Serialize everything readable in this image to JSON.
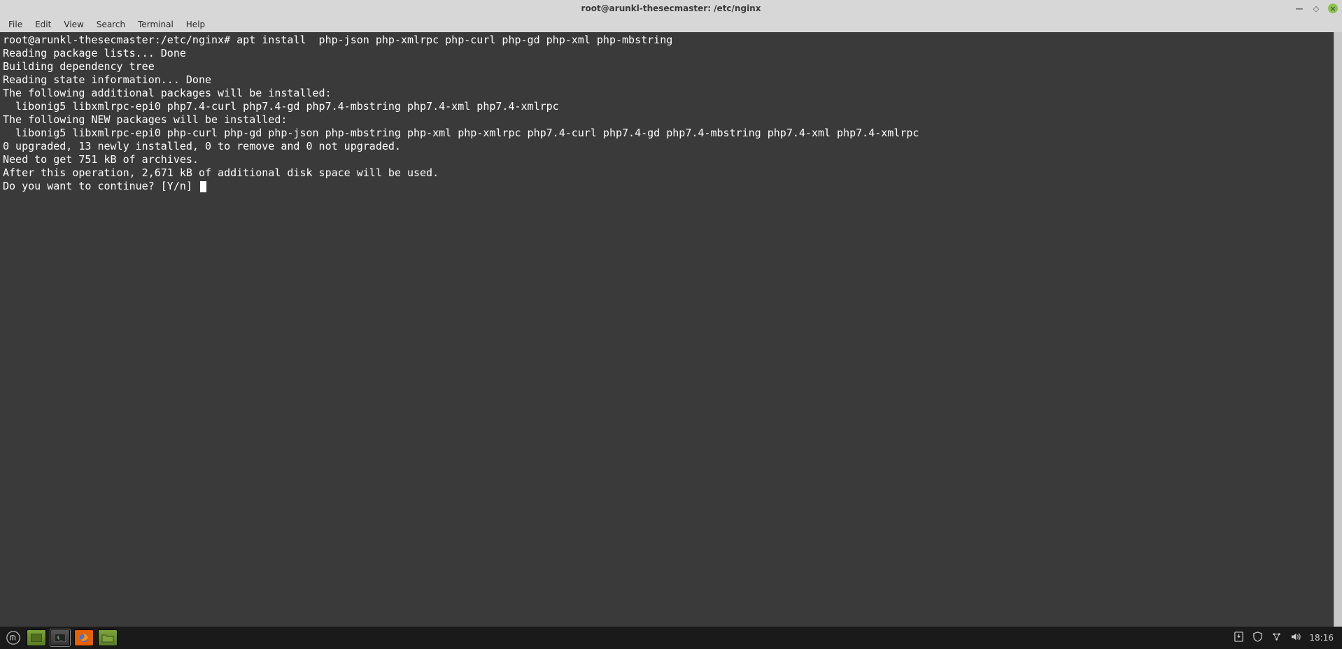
{
  "window": {
    "title": "root@arunkl-thesecmaster: /etc/nginx"
  },
  "menu": {
    "items": [
      "File",
      "Edit",
      "View",
      "Search",
      "Terminal",
      "Help"
    ]
  },
  "terminal": {
    "prompt": "root@arunkl-thesecmaster:/etc/nginx#",
    "command": " apt install  php-json php-xmlrpc php-curl php-gd php-xml php-mbstring",
    "lines": [
      "Reading package lists... Done",
      "Building dependency tree",
      "Reading state information... Done",
      "The following additional packages will be installed:",
      "  libonig5 libxmlrpc-epi0 php7.4-curl php7.4-gd php7.4-mbstring php7.4-xml php7.4-xmlrpc",
      "The following NEW packages will be installed:",
      "  libonig5 libxmlrpc-epi0 php-curl php-gd php-json php-mbstring php-xml php-xmlrpc php7.4-curl php7.4-gd php7.4-mbstring php7.4-xml php7.4-xmlrpc",
      "0 upgraded, 13 newly installed, 0 to remove and 0 not upgraded.",
      "Need to get 751 kB of archives.",
      "After this operation, 2,671 kB of additional disk space will be used.",
      "Do you want to continue? [Y/n] "
    ]
  },
  "panel": {
    "clock": "18:16"
  }
}
